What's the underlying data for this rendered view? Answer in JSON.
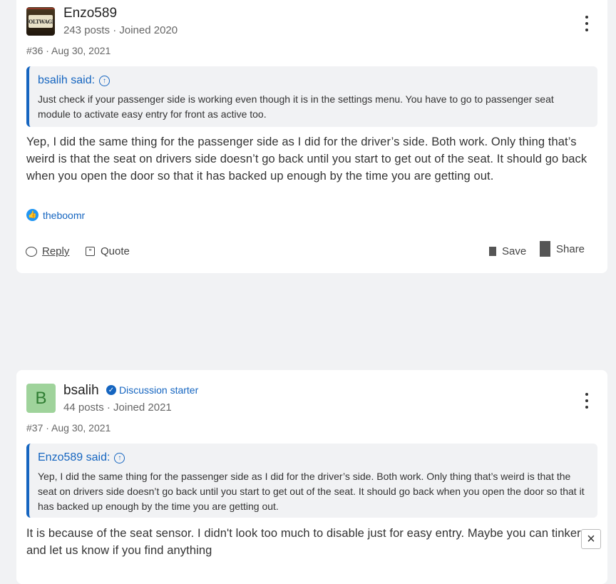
{
  "posts": [
    {
      "username": "Enzo589",
      "avatar_plate": "VOLTWAGN",
      "stats": "243 posts · Joined 2020",
      "number_date": "#36 · Aug 30, 2021",
      "quote": {
        "author": "bsalih said:",
        "text": "Just check if your passenger side is working even though it is in the settings menu. You have to go to passenger seat module to activate easy entry for front as active too."
      },
      "body": "Yep, I did the same thing for the passenger side as I did for the driver’s side. Both work. Only thing that’s weird is that the seat on drivers side doesn’t go back until you start to get out of the seat. It should go back when you open the door so that it has backed up enough by the time you are getting out.",
      "reaction_user": "theboomr",
      "actions": {
        "reply": "Reply",
        "quote": "Quote",
        "save": "Save",
        "share": "Share"
      }
    },
    {
      "username": "bsalih",
      "avatar_letter": "B",
      "badge": "Discussion starter",
      "stats": "44 posts · Joined 2021",
      "number_date": "#37 · Aug 30, 2021",
      "quote": {
        "author": "Enzo589 said:",
        "text": "Yep, I did the same thing for the passenger side as I did for the driver’s side. Both work. Only thing that’s weird is that the seat on drivers side doesn’t go back until you start to get out of the seat. It should go back when you open the door so that it has backed up enough by the time you are getting out."
      },
      "body": "It is because of the seat sensor. I didn't look too much to disable just for easy entry. Maybe you can tinker and let us know if you find anything"
    }
  ],
  "close_label": "×",
  "colors": {
    "accent": "#1565c0",
    "page_bg": "#f1f2f4",
    "avatar_green": "#9fd39b"
  }
}
